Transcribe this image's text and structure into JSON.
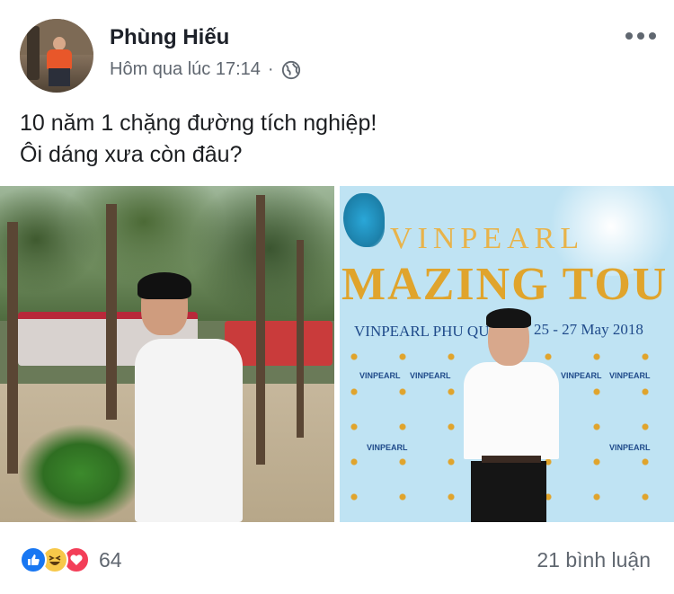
{
  "post": {
    "author": "Phùng Hiếu",
    "timestamp": "Hôm qua lúc 17:14",
    "separator": "·",
    "privacy_icon": "globe-icon",
    "menu_icon": "more-options-icon",
    "text_lines": [
      "10 năm 1 chặng đường tích nghiệp!",
      "Ôi dáng xưa còn đâu?"
    ]
  },
  "photos": {
    "right": {
      "title_line1": "VINPEARL",
      "title_line2": "MAZING TOU",
      "subtitle": "VINPEARL PHU QU",
      "date": "25 - 27 May 2018",
      "logo_word": "VINPEARL"
    }
  },
  "footer": {
    "reaction_icons": [
      "like-icon",
      "haha-icon",
      "love-icon"
    ],
    "reaction_count": "64",
    "comment_count": "21 bình luận"
  },
  "colors": {
    "like": "#1877f2",
    "haha": "#f7c84a",
    "love": "#f33e58",
    "secondary_text": "#606770"
  }
}
